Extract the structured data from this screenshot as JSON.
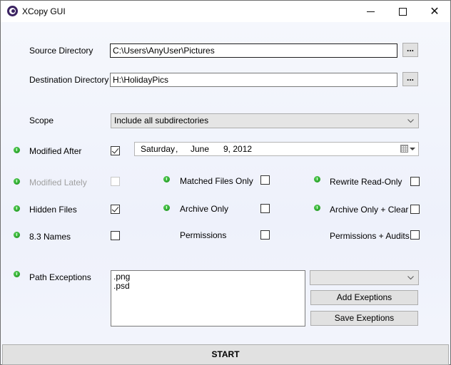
{
  "window": {
    "title": "XCopy GUI",
    "icon": "xcopy-app-icon",
    "controls": {
      "minimize": "minimize-icon",
      "maximize": "maximize-icon",
      "close_glyph": "✕"
    }
  },
  "source": {
    "label": "Source Directory",
    "value": "C:\\Users\\AnyUser\\Pictures",
    "browse_label": "..."
  },
  "destination": {
    "label": "Destination Directory",
    "value": "H:\\HolidayPics",
    "browse_label": "..."
  },
  "scope": {
    "label": "Scope",
    "selected": "Include all subdirectories"
  },
  "modified_after": {
    "label": "Modified After",
    "checked": true,
    "date": {
      "weekday": "Saturday",
      "sep": ",",
      "month": "June",
      "day_year": "9, 2012"
    }
  },
  "options": {
    "modified_lately": {
      "label": "Modified Lately",
      "checked": false,
      "enabled": false
    },
    "hidden_files": {
      "label": "Hidden Files",
      "checked": true
    },
    "names_83": {
      "label": "8.3 Names",
      "checked": false
    },
    "matched_files_only": {
      "label": "Matched Files Only",
      "checked": false
    },
    "archive_only": {
      "label": "Archive Only",
      "checked": false
    },
    "permissions": {
      "label": "Permissions",
      "checked": false
    },
    "rewrite_read_only": {
      "label": "Rewrite Read-Only",
      "checked": false
    },
    "archive_only_clear": {
      "label": "Archive Only + Clear",
      "checked": false
    },
    "permissions_audits": {
      "label": "Permissions + Audits",
      "checked": false
    }
  },
  "path_exceptions": {
    "label": "Path Exceptions",
    "value": ".png\n.psd",
    "combo_selected": "",
    "add_label": "Add Exeptions",
    "save_label": "Save Exeptions"
  },
  "start": {
    "label": "START"
  },
  "colors": {
    "info_dot": "#2ea82e",
    "button_bg": "#e1e1e1",
    "disabled_text": "#a0a0a0",
    "app_icon": "#3c2462"
  }
}
